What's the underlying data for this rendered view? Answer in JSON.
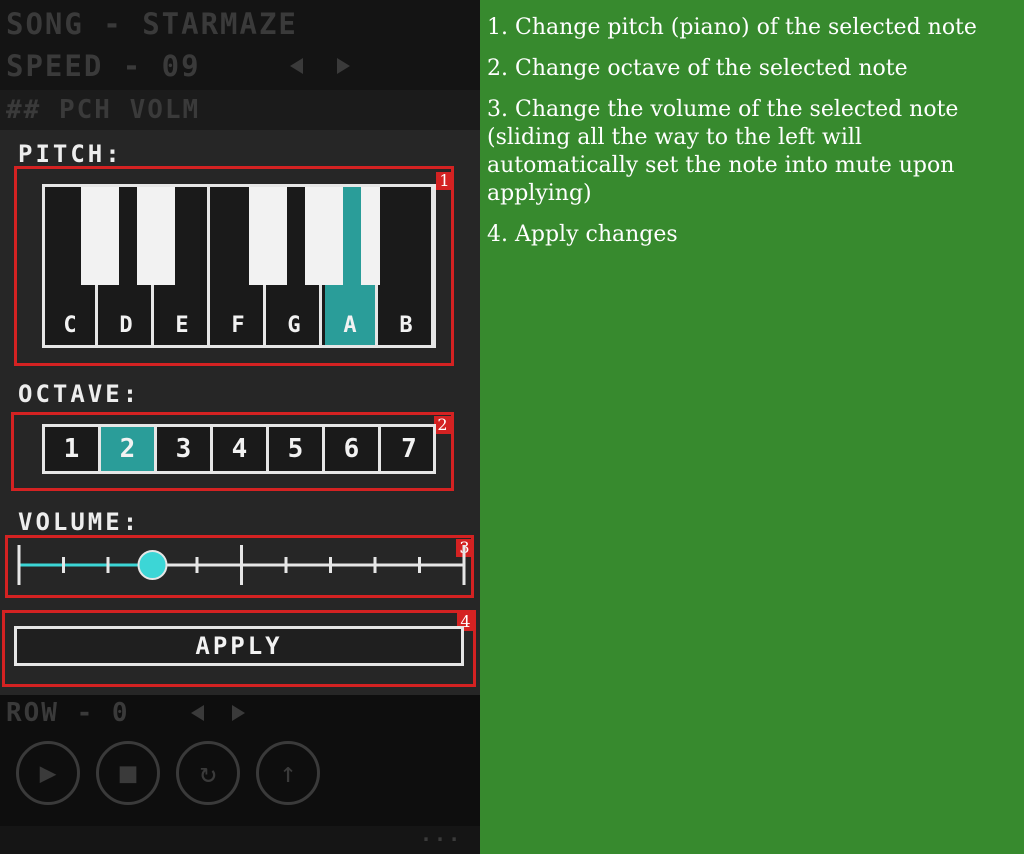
{
  "header": {
    "song_label": "SONG - STARMAZE",
    "speed_label": "SPEED - 09"
  },
  "columns": {
    "text": "## PCH VOLM"
  },
  "pitch": {
    "label": "PITCH:",
    "keys": [
      "C",
      "D",
      "E",
      "F",
      "G",
      "A",
      "B"
    ],
    "selected_key": "A",
    "badge": "1"
  },
  "octave": {
    "label": "OCTAVE:",
    "options": [
      "1",
      "2",
      "3",
      "4",
      "5",
      "6",
      "7"
    ],
    "selected": "2",
    "badge": "2"
  },
  "volume": {
    "label": "VOLUME:",
    "value_fraction": 0.3,
    "badge": "3"
  },
  "apply": {
    "label": "APPLY",
    "badge": "4"
  },
  "row": {
    "label": "ROW - 0"
  },
  "footer": {
    "dots": "..."
  },
  "colors": {
    "accent": "#2a9d99",
    "slider_accent": "#3cd6d6",
    "highlight": "#d42222",
    "background_green": "#378a2e"
  },
  "icons": [
    "play-icon",
    "stop-icon",
    "loop-icon",
    "upload-icon"
  ],
  "instructions": [
    "1. Change pitch (piano) of the selected note",
    "2. Change octave of the selected note",
    "3. Change the volume of the selected note (sliding all the way to the left will automatically set the note into mute upon applying)",
    "4. Apply changes"
  ]
}
